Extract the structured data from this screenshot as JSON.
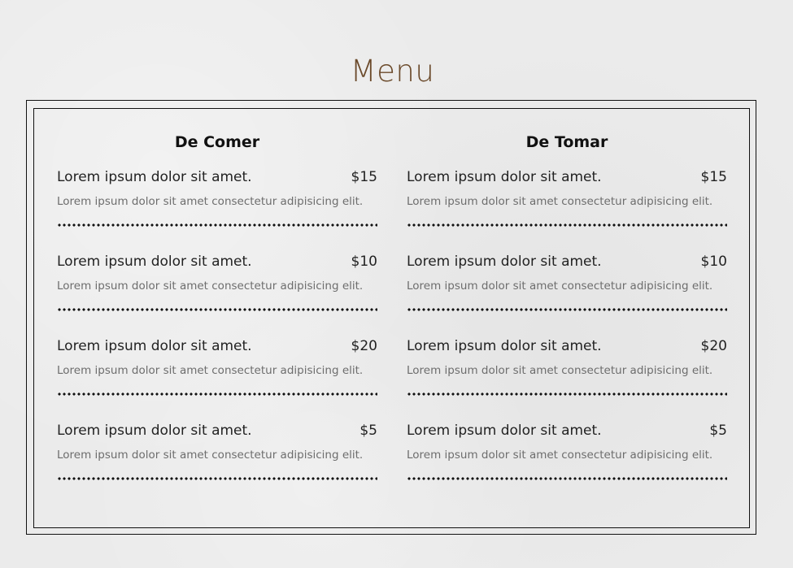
{
  "page": {
    "title": "Menu"
  },
  "columns": [
    {
      "title": "De Comer",
      "items": [
        {
          "name": "Lorem ipsum dolor sit amet.",
          "price": "$15",
          "desc": "Lorem ipsum dolor sit amet consectetur adipisicing elit."
        },
        {
          "name": "Lorem ipsum dolor sit amet.",
          "price": "$10",
          "desc": "Lorem ipsum dolor sit amet consectetur adipisicing elit."
        },
        {
          "name": "Lorem ipsum dolor sit amet.",
          "price": "$20",
          "desc": "Lorem ipsum dolor sit amet consectetur adipisicing elit."
        },
        {
          "name": "Lorem ipsum dolor sit amet.",
          "price": "$5",
          "desc": "Lorem ipsum dolor sit amet consectetur adipisicing elit."
        }
      ]
    },
    {
      "title": "De Tomar",
      "items": [
        {
          "name": "Lorem ipsum dolor sit amet.",
          "price": "$15",
          "desc": "Lorem ipsum dolor sit amet consectetur adipisicing elit."
        },
        {
          "name": "Lorem ipsum dolor sit amet.",
          "price": "$10",
          "desc": "Lorem ipsum dolor sit amet consectetur adipisicing elit."
        },
        {
          "name": "Lorem ipsum dolor sit amet.",
          "price": "$20",
          "desc": "Lorem ipsum dolor sit amet consectetur adipisicing elit."
        },
        {
          "name": "Lorem ipsum dolor sit amet.",
          "price": "$5",
          "desc": "Lorem ipsum dolor sit amet consectetur adipisicing elit."
        }
      ]
    }
  ],
  "colors": {
    "title": "#6b4a2b",
    "background": "#ebebeb",
    "text": "#222222",
    "muted": "#6d6d6d",
    "border": "#111111"
  }
}
